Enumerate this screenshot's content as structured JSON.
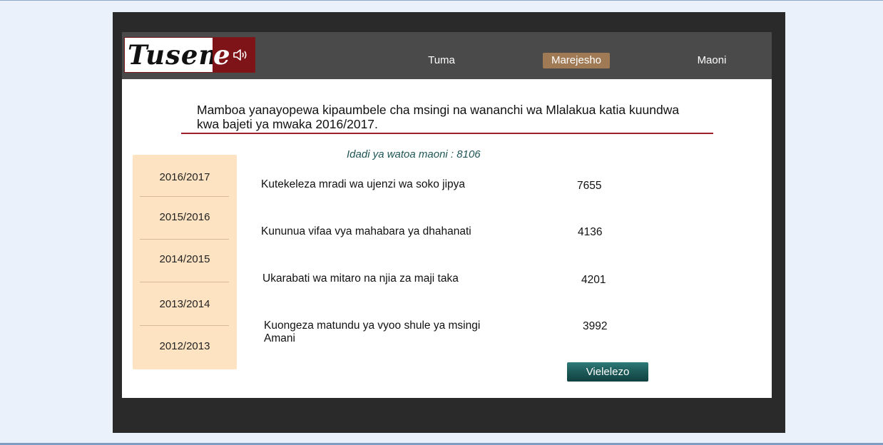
{
  "brand": {
    "part1": "Tuseme",
    "part2": "e"
  },
  "nav": {
    "items": [
      {
        "label": "Tuma"
      },
      {
        "label": "Marejesho"
      },
      {
        "label": "Maoni"
      }
    ],
    "active": "Marejesho"
  },
  "headline": "Mamboa yanayopewa kipaumbele cha msingi na wananchi wa Mlalakua katia kuundwa kwa bajeti ya mwaka 2016/2017.",
  "respondents_label": "Idadi ya watoa maoni :  8106",
  "years": [
    "2016/2017",
    "2015/2016",
    "2014/2015",
    "2013/2014",
    "2012/2013"
  ],
  "priorities": [
    {
      "label": "Kutekeleza mradi wa ujenzi wa soko jipya",
      "value": "7655"
    },
    {
      "label": "Kununua vifaa vya mahabara ya dhahanati",
      "value": "4136"
    },
    {
      "label": "Ukarabati wa mitaro na njia za maji taka",
      "value": "4201"
    },
    {
      "label": "Kuongeza matundu ya vyoo shule ya msingi Amani",
      "value": "3992"
    }
  ],
  "details_button": "Vielelezo",
  "colors": {
    "accent_nav": "#a07a55",
    "brand_red": "#7e1418",
    "button_teal": "#1f5d5b",
    "sidebar_bg": "#fde3c2",
    "headline_rule": "#a01e2b"
  }
}
